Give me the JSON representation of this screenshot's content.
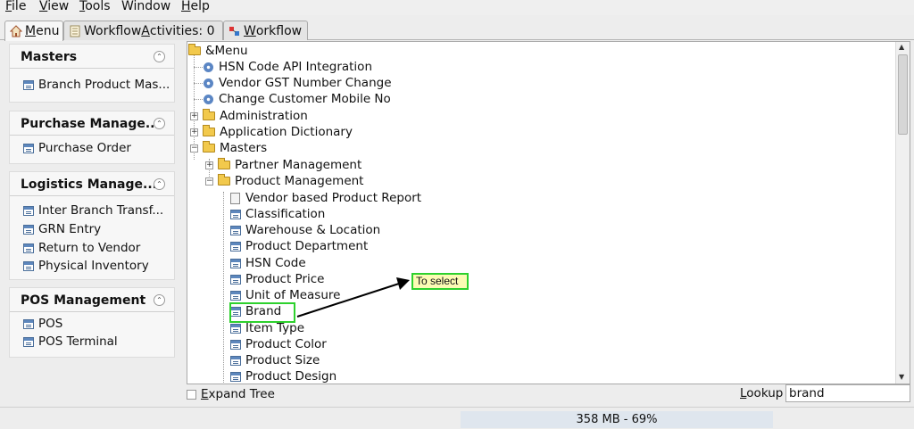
{
  "menubar": {
    "file": {
      "u": "F",
      "rest": "ile"
    },
    "view": {
      "u": "V",
      "rest": "iew"
    },
    "tools": {
      "u": "T",
      "rest": "ools"
    },
    "window": {
      "pre": "",
      "label": "Window"
    },
    "help": {
      "u": "H",
      "rest": "elp"
    }
  },
  "tabs": [
    {
      "u": "M",
      "rest": "enu",
      "icon": "home-icon"
    },
    {
      "pre": "Workflow ",
      "u": "A",
      "rest": "ctivities: 0",
      "icon": "activities-icon"
    },
    {
      "u": "W",
      "rest": "orkflow",
      "icon": "workflow-icon"
    }
  ],
  "left_panel": {
    "sections": [
      {
        "title": "Masters",
        "items": [
          "Branch Product Mas..."
        ]
      },
      {
        "title": "Purchase Manage...",
        "items": [
          "Purchase Order"
        ]
      },
      {
        "title": "Logistics Manage...",
        "items": [
          "Inter Branch Transf...",
          "GRN Entry",
          "Return to Vendor",
          "Physical Inventory"
        ]
      },
      {
        "title": "POS Management",
        "items": [
          "POS",
          "POS Terminal"
        ]
      }
    ]
  },
  "tree": {
    "root": "&Menu",
    "nodes": [
      "HSN Code API Integration",
      "Vendor GST Number Change",
      "Change Customer Mobile No",
      "Administration",
      "Application Dictionary",
      "Masters",
      "Partner Management",
      "Product Management",
      "Vendor based Product Report",
      "Classification",
      "Warehouse & Location",
      "Product Department",
      "HSN Code",
      "Product Price",
      "Unit of Measure",
      "Brand",
      "Item Type",
      "Product Color",
      "Product Size",
      "Product Design"
    ]
  },
  "annotation": {
    "callout": "To select",
    "color": "#2dd12d"
  },
  "bottom": {
    "expand_u": "E",
    "expand_rest": "xpand Tree",
    "lookup_u": "L",
    "lookup_rest": "ookup",
    "lookup_value": "brand"
  },
  "status": {
    "memory": "358 MB - 69%"
  }
}
